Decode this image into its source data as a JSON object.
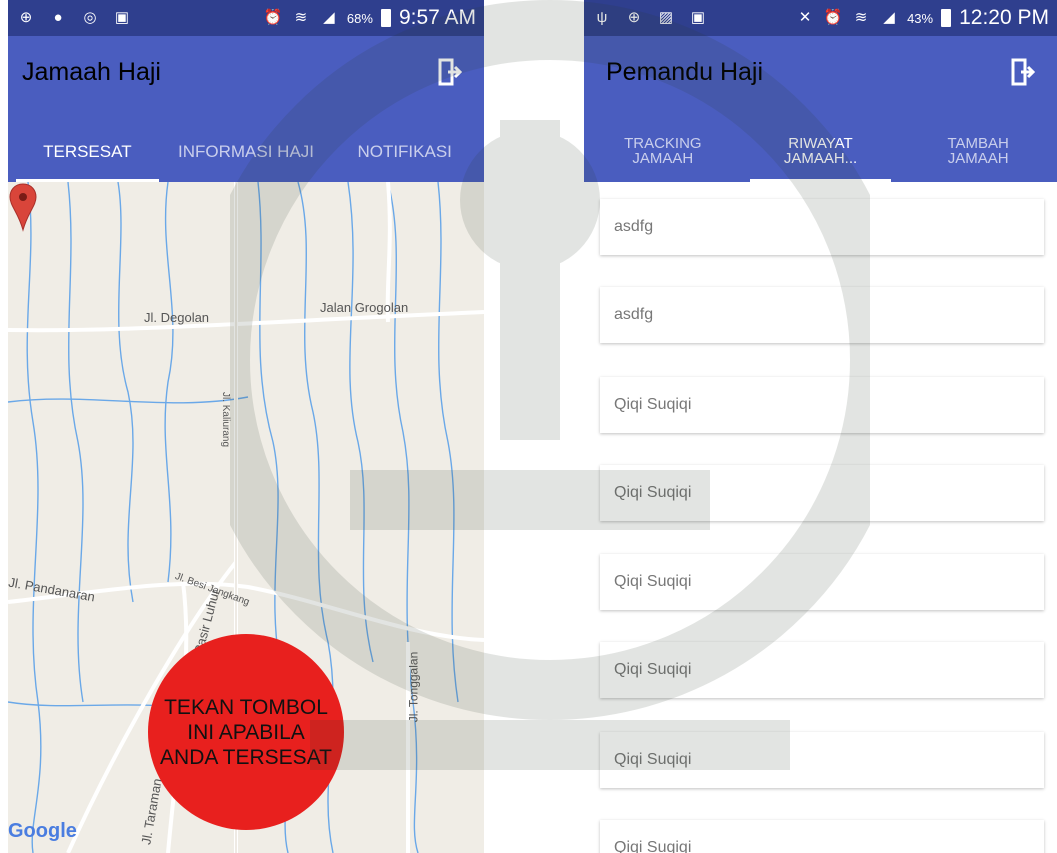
{
  "left_screen": {
    "status": {
      "battery_pct": "68%",
      "clock": "9:57 AM"
    },
    "app_title": "Jamaah Haji",
    "tabs": [
      {
        "label": "TERSESAT",
        "active": true
      },
      {
        "label": "INFORMASI HAJI",
        "active": false
      },
      {
        "label": "NOTIFIKASI",
        "active": false
      }
    ],
    "map": {
      "labels": {
        "degolan": "Jl. Degolan",
        "grogolan": "Jalan Grogolan",
        "kaliurang": "Jl. Kaliurang",
        "pandanaran": "Jl. Pandanaran",
        "besi_jangkang": "Jl. Besi Jangkang",
        "pasir_luhur": "Jl. Pasir Luhur",
        "tonggalan": "Jl. Tonggalan",
        "taraman": "Jl. Taraman"
      },
      "google_logo": "Google"
    },
    "panic_button": {
      "line1": "TEKAN TOMBOL",
      "line2": "INI APABILA",
      "line3": "ANDA TERSESAT"
    }
  },
  "right_screen": {
    "status": {
      "battery_pct": "43%",
      "clock": "12:20 PM"
    },
    "app_title": "Pemandu Haji",
    "tabs": [
      {
        "line1": "TRACKING",
        "line2": "JAMAAH",
        "active": false
      },
      {
        "line1": "RIWAYAT",
        "line2": "JAMAAH...",
        "active": true
      },
      {
        "line1": "TAMBAH",
        "line2": "JAMAAH",
        "active": false
      }
    ],
    "list_items": [
      "asdfg",
      "asdfg",
      "Qiqi Suqiqi",
      "Qiqi Suqiqi",
      "Qiqi Suqiqi",
      "Qiqi Suqiqi",
      "Qiqi Suqiqi",
      "Qiqi Suqiqi"
    ]
  },
  "colors": {
    "status_bar": "#2f3f8e",
    "app_bar": "#4a5dbf",
    "panic_red": "#e8201e",
    "map_bg": "#f0ede6"
  },
  "icons": [
    "location-icon",
    "line-icon",
    "instagram-icon",
    "bbm-icon",
    "alarm-icon",
    "wifi-icon",
    "signal-icon",
    "battery-icon",
    "usb-icon",
    "gallery-icon",
    "mute-icon",
    "logout-icon",
    "map-marker-icon"
  ]
}
